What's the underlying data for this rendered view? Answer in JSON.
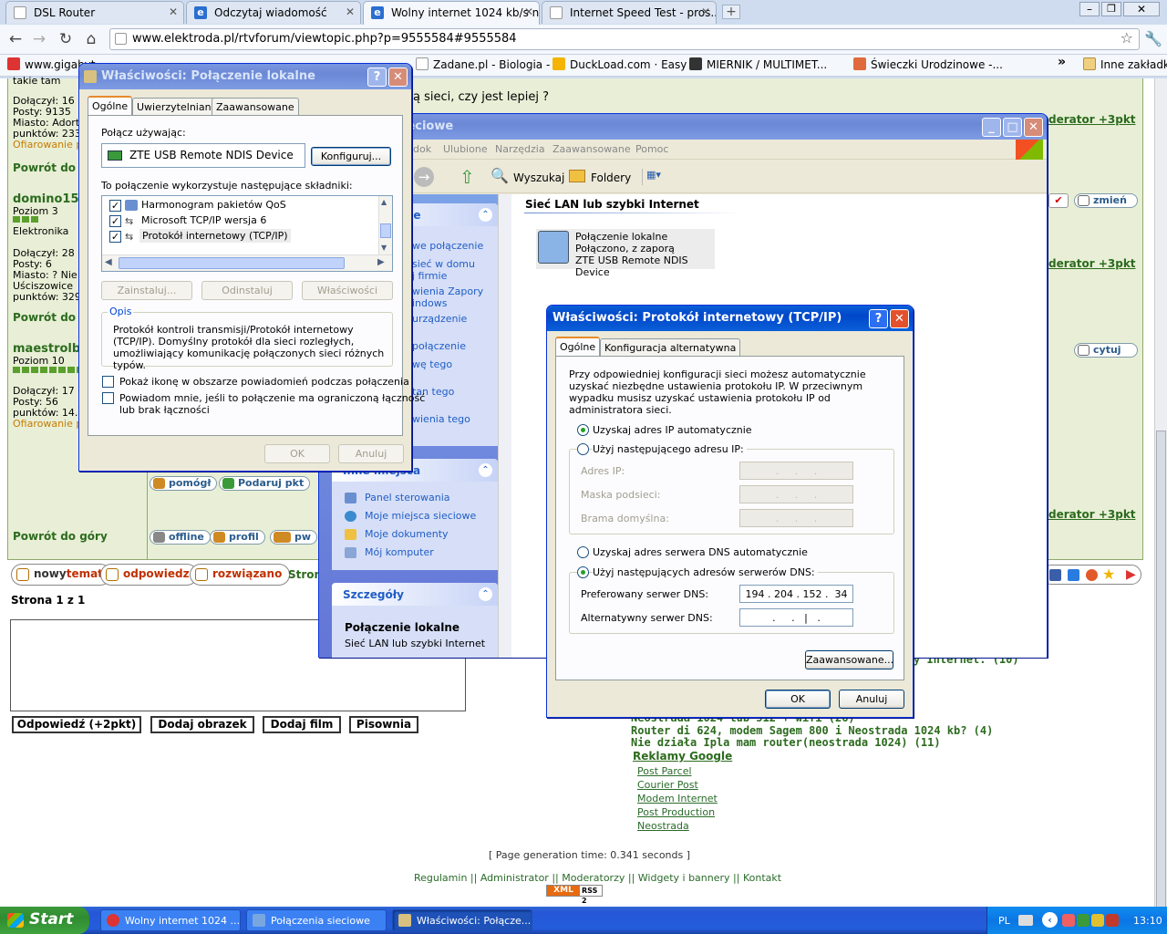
{
  "browser": {
    "tabs": [
      {
        "title": "DSL Router"
      },
      {
        "title": "Odczytaj wiadomość"
      },
      {
        "title": "Wolny internet 1024 kb/s n..."
      },
      {
        "title": "Internet Speed Test - pros..."
      }
    ],
    "url": "www.elektroda.pl/rtvforum/viewtopic.php?p=9555584#9555584",
    "bookmarks": [
      {
        "label": "www.gigabyt..."
      },
      {
        "label": "Zadane.pl - Biologia - ..."
      },
      {
        "label": "DuckLoad.com · Easy ..."
      },
      {
        "label": "MIERNIK / MULTIMET..."
      },
      {
        "label": "Świeczki Urodzinowe -..."
      },
      {
        "label": "Inne zakładki"
      }
    ],
    "bookmarks_more": "»"
  },
  "forum": {
    "topline_left": "takie tam",
    "topline_right": "ą sieci, czy jest lepiej ?",
    "user1": {
      "joined": "Dołączył: 16",
      "posts": "Posty: 9135",
      "city": "Miasto: Adort",
      "offered": "Ofiarowanie p",
      "points": "punktów: 233"
    },
    "back_to_top": "Powrót do góry",
    "back_to_top_short": "Powrót do g",
    "user2": {
      "name": "domino150",
      "level": "Poziom 3",
      "field": "Elektronika",
      "joined": "Dołączył: 28",
      "posts": "Posty: 6",
      "city": "Miasto: ? Nie",
      "city2": "Uściszowice",
      "points": "punktów: 329"
    },
    "user3": {
      "name": "maestrolbk",
      "level": "Poziom 10",
      "joined": "Dołączył: 17",
      "posts": "Posty: 56",
      "points": "punktów: 14.",
      "offered": "Ofiarowanie p"
    },
    "moderator_reward": "derator +3pkt",
    "change_label": "zmień",
    "quote_label": "cytuj",
    "help_label": "pomógł",
    "gift_label": "Podaruj pkt",
    "offline_label": "offline",
    "profile_label": "profil",
    "pw_label": "pw",
    "new_topic": "nowytemat",
    "new_prefix": "nowy",
    "new_suffix": "temat",
    "reply": "odpowiedz",
    "solved": "rozwiązano",
    "page_label": "Strona 1 z 1",
    "strona_trunc": "Stron",
    "btn_reply_pts": "Odpowiedź (+2pkt)",
    "btn_add_image": "Dodaj obrazek",
    "btn_add_film": "Dodaj film",
    "btn_spelling": "Pisownia",
    "related_top": "y Internet. (10)",
    "related": [
      "Neostrada 1024 lub 512 + wifi (26)",
      "Router di 624, modem Sagem 800 i Neostrada 1024 kb? (4)",
      "Nie działa Ipla mam router(neostrada 1024) (11)"
    ],
    "google_ads_title": "Reklamy Google",
    "ads": [
      "Post Parcel",
      "Courier Post",
      "Modem Internet",
      "Post Production",
      "Neostrada"
    ],
    "gen_time": "[ Page generation time: 0.341 seconds ]",
    "footer_links": [
      "Regulamin",
      "Administrator",
      "Moderatorzy",
      "Widgety i bannery",
      "Kontakt"
    ],
    "footer_sep": "||",
    "xml_badge": "XML",
    "rss_badge": "RSS 2"
  },
  "explorer": {
    "title_trunc": "ieciowe",
    "menu": [
      "dok",
      "Ulubione",
      "Narzędzia",
      "Zaawansowane",
      "Pomoc"
    ],
    "toolbar_search": "Wyszukaj",
    "toolbar_folders": "Foldery",
    "side_title": "owe",
    "side_links": [
      "we połączenie",
      "sieć w domu",
      "j firmie",
      "wienia Zapory",
      "indows",
      "urządzenie",
      "połączenie",
      "wę tego",
      "tan tego",
      "wienia tego"
    ],
    "other_places_title": "Inne miejsca",
    "other_places": [
      "Panel sterowania",
      "Moje miejsca sieciowe",
      "Moje dokumenty",
      "Mój komputer"
    ],
    "details_title": "Szczegóły",
    "details_name": "Połączenie lokalne",
    "details_type": "Sieć LAN lub szybki Internet",
    "group_header": "Sieć LAN lub szybki Internet",
    "conn_name": "Połączenie lokalne",
    "conn_status": "Połączono, z zaporą",
    "conn_device": "ZTE USB Remote NDIS Device"
  },
  "conn_props": {
    "title": "Właściwości: Połączenie lokalne",
    "tabs": [
      "Ogólne",
      "Uwierzytelnianie",
      "Zaawansowane"
    ],
    "connect_using": "Połącz używając:",
    "device": "ZTE USB Remote NDIS Device",
    "configure": "Konfiguruj...",
    "components_label": "To połączenie wykorzystuje następujące składniki:",
    "components": [
      "Harmonogram pakietów QoS",
      "Microsoft TCP/IP wersja 6",
      "Protokół internetowy (TCP/IP)"
    ],
    "install": "Zainstaluj...",
    "uninstall": "Odinstaluj",
    "properties": "Właściwości",
    "desc_title": "Opis",
    "desc": "Protokół kontroli transmisji/Protokół internetowy (TCP/IP). Domyślny protokół dla sieci rozległych, umożliwiający komunikację połączonych sieci różnych typów.",
    "show_icon": "Pokaż ikonę w obszarze powiadomień podczas połączenia",
    "notify": "Powiadom mnie, jeśli to połączenie ma ograniczoną łączność",
    "notify2": "lub brak łączności",
    "ok": "OK",
    "cancel": "Anuluj",
    "help_btn": "?",
    "close_btn": "X"
  },
  "tcpip": {
    "title": "Właściwości: Protokół internetowy (TCP/IP)",
    "tabs": [
      "Ogólne",
      "Konfiguracja alternatywna"
    ],
    "intro": "Przy odpowiedniej konfiguracji sieci możesz automatycznie uzyskać niezbędne ustawienia protokołu IP. W przeciwnym wypadku musisz uzyskać ustawienia protokołu IP od administratora sieci.",
    "auto_ip": "Uzyskaj adres IP automatycznie",
    "manual_ip": "Użyj następującego adresu IP:",
    "ip_label": "Adres IP:",
    "mask_label": "Maska podsieci:",
    "gw_label": "Brama domyślna:",
    "auto_dns": "Uzyskaj adres serwera DNS automatycznie",
    "manual_dns": "Użyj następujących adresów serwerów DNS:",
    "pref_dns_label": "Preferowany serwer DNS:",
    "alt_dns_label": "Alternatywny serwer DNS:",
    "pref_dns": "194 . 204 . 152 .  34",
    "alt_dns": "  .     .   |   .  ",
    "empty_ip": "  .     .     .  ",
    "advanced": "Zaawansowane...",
    "ok": "OK",
    "cancel": "Anuluj"
  },
  "taskbar": {
    "start": "Start",
    "tasks": [
      "Wolny internet 1024 ...",
      "Połączenia sieciowe",
      "Właściwości: Połącze..."
    ],
    "lang": "PL",
    "clock": "13:10"
  },
  "colors": {
    "xp_blue": "#0a5fd8",
    "forum_green": "#2c6b1e",
    "forum_bg": "#e8efd6"
  }
}
